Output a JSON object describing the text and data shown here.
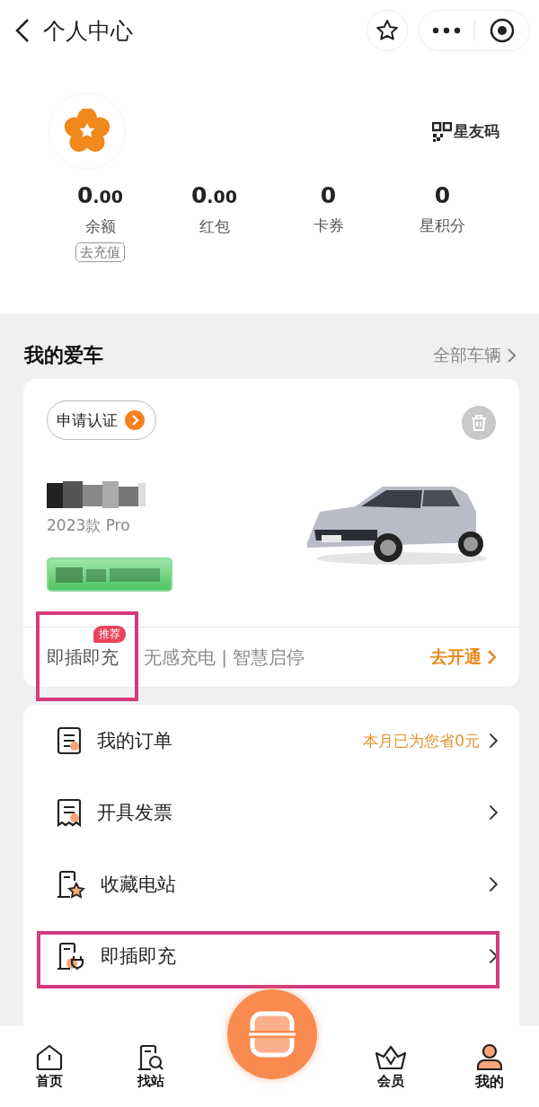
{
  "header": {
    "title": "个人中心"
  },
  "profile": {
    "qr_label": "星友码"
  },
  "stats": [
    {
      "value_main": "0",
      "value_fraction": ".00",
      "label": "余额",
      "action": "去充值"
    },
    {
      "value_main": "0",
      "value_fraction": ".00",
      "label": "红包"
    },
    {
      "value_main": "0",
      "label": "卡券"
    },
    {
      "value_main": "0",
      "label": "星积分"
    }
  ],
  "my_car": {
    "title": "我的爱车",
    "link": "全部车辆",
    "verify_button": "申请认证",
    "model": "2023款 Pro",
    "feature": {
      "name": "即插即充",
      "badge": "推荐",
      "description": "无感充电 | 智慧启停",
      "action": "去开通",
      "highlighted": true
    }
  },
  "menu": [
    {
      "kind": "orders",
      "label": "我的订单",
      "note": "本月已为您省0元",
      "highlighted": false
    },
    {
      "kind": "invoice",
      "label": "开具发票",
      "highlighted": false
    },
    {
      "kind": "favorite",
      "label": "收藏电站",
      "highlighted": false
    },
    {
      "kind": "plug",
      "label": "即插即充",
      "highlighted": true
    }
  ],
  "tabs": [
    {
      "kind": "home",
      "label": "首页",
      "selected": false
    },
    {
      "kind": "find",
      "label": "找站",
      "selected": false
    },
    {
      "kind": "scan"
    },
    {
      "kind": "member",
      "label": "会员",
      "selected": false
    },
    {
      "kind": "me",
      "label": "我的",
      "selected": true
    }
  ]
}
